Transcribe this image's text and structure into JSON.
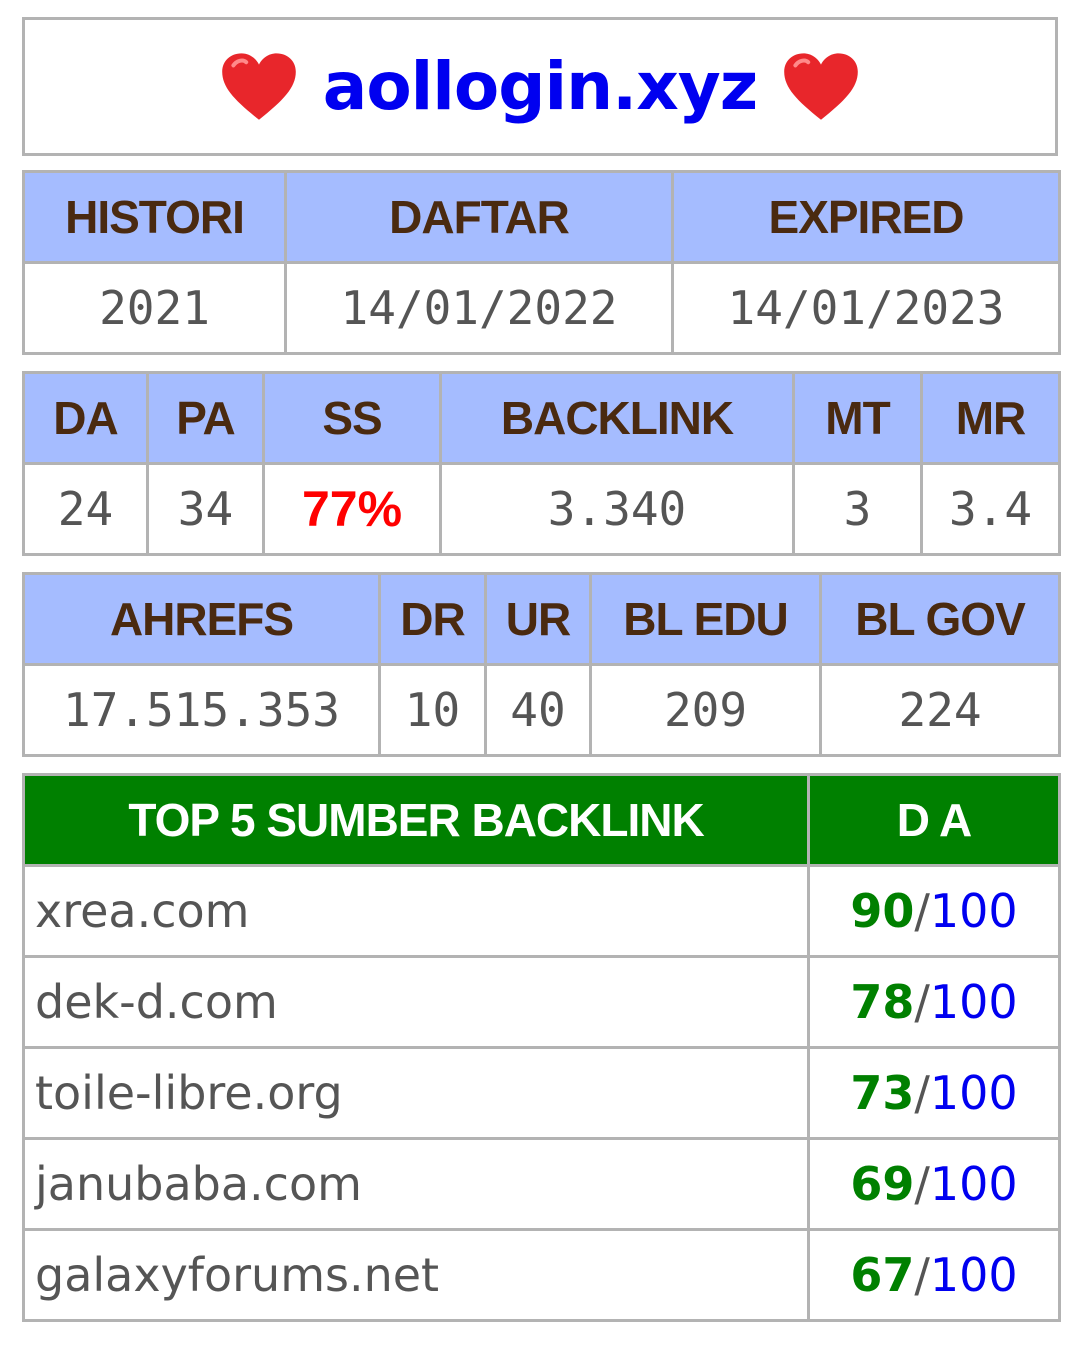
{
  "title": {
    "domain": "aollogin.xyz",
    "left_icon": "heart-icon",
    "right_icon": "heart-icon",
    "heart_color": "#e8262b"
  },
  "registration": {
    "headers": [
      "HISTORI",
      "DAFTAR",
      "EXPIRED"
    ],
    "values": [
      "2021",
      "14/01/2022",
      "14/01/2023"
    ]
  },
  "metrics": {
    "headers": [
      "DA",
      "PA",
      "SS",
      "BACKLINK",
      "MT",
      "MR"
    ],
    "values": [
      "24",
      "34",
      "77%",
      "3.340",
      "3",
      "3.4"
    ]
  },
  "ahrefs": {
    "headers": [
      "AHREFS",
      "DR",
      "UR",
      "BL EDU",
      "BL GOV"
    ],
    "values": [
      "17.515.353",
      "10",
      "40",
      "209",
      "224"
    ]
  },
  "top_backlinks": {
    "header_source": "TOP 5 SUMBER BACKLINK",
    "header_da": "D A",
    "rows": [
      {
        "site": "xrea.com",
        "score": "90",
        "sep": "/",
        "max": "100"
      },
      {
        "site": "dek-d.com",
        "score": "78",
        "sep": "/",
        "max": "100"
      },
      {
        "site": "toile-libre.org",
        "score": "73",
        "sep": "/",
        "max": "100"
      },
      {
        "site": "janubaba.com",
        "score": "69",
        "sep": "/",
        "max": "100"
      },
      {
        "site": "galaxyforums.net",
        "score": "67",
        "sep": "/",
        "max": "100"
      }
    ]
  },
  "colors": {
    "header_bg": "#a5bcff",
    "header_text": "#4a2a10",
    "green_header_bg": "#008000",
    "highlight_red": "#ff0000",
    "link_blue": "#0000f0"
  }
}
